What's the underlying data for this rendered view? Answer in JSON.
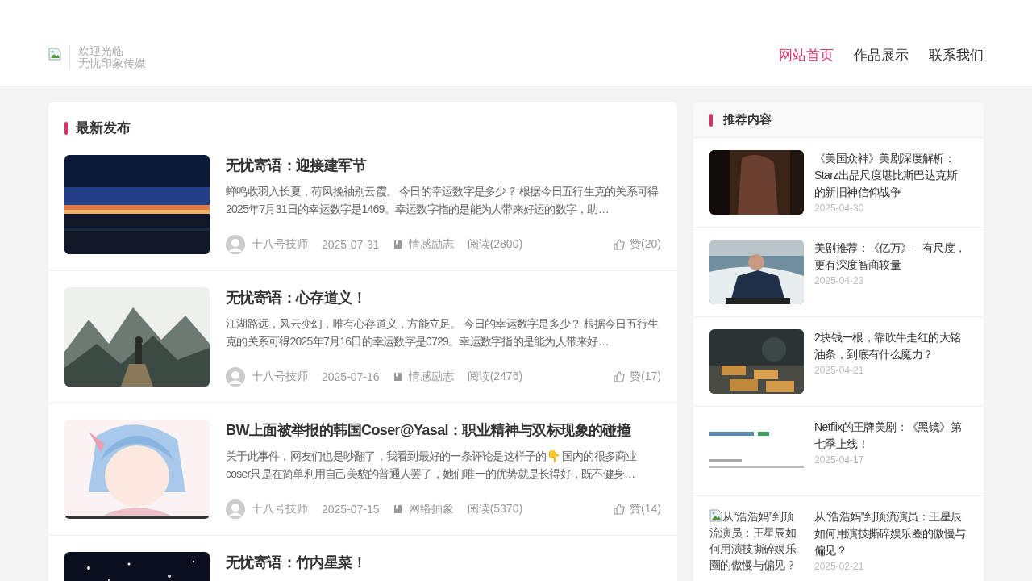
{
  "header": {
    "logo": {
      "kind": "broken-image"
    },
    "welcome": "欢迎光临",
    "site_name": "无忧印象传媒",
    "nav": [
      {
        "label": "网站首页",
        "selected": true
      },
      {
        "label": "作品展示",
        "selected": false
      },
      {
        "label": "联系我们",
        "selected": false
      }
    ]
  },
  "latest": {
    "title": "最新发布",
    "articles": [
      {
        "title": "无忧寄语：迎接建军节",
        "excerpt": "蝉鸣收羽入长夏，荷风挽袖别云霞。 今日的幸运数字是多少？ 根据今日五行生克的关系可得2025年7月31日的幸运数字是1469。幸运数字指的是能为人带来好运的数字，助…",
        "author": "十八号技师",
        "date": "2025-07-31",
        "category": "情感励志",
        "reads": "阅读(2800)",
        "likes": "赞(20)"
      },
      {
        "title": "无忧寄语：心存道义！",
        "excerpt": "江湖路远，风云变幻，唯有心存道义，方能立足。 今日的幸运数字是多少？ 根据今日五行生克的关系可得2025年7月16日的幸运数字是0729。幸运数字指的是能为人带来好…",
        "author": "十八号技师",
        "date": "2025-07-16",
        "category": "情感励志",
        "reads": "阅读(2476)",
        "likes": "赞(17)"
      },
      {
        "title": "BW上面被举报的韩国Coser@Yasal：职业精神与双标现象的碰撞",
        "excerpt": "关于此事件，网友们也是吵翻了，我看到最好的一条评论是这样子的👇 国内的很多商业coser只是在简单利用自己美貌的普通人罢了，她们唯一的优势就是长得好，既不健身…",
        "author": "十八号技师",
        "date": "2025-07-15",
        "category": "网络抽象",
        "reads": "阅读(5370)",
        "likes": "赞(14)"
      },
      {
        "title": "无忧寄语：竹内星菜！"
      }
    ]
  },
  "recommended": {
    "title": "推荐内容",
    "items": [
      {
        "title": "《美国众神》美剧深度解析：Starz出品尺度堪比斯巴达克斯的新旧神信仰战争",
        "date": "2025-04-30"
      },
      {
        "title": "美剧推荐：《亿万》—有尺度，更有深度智商较量",
        "date": "2025-04-23"
      },
      {
        "title": "2块钱一根，靠吹牛走红的大铭油条，到底有什么魔力？",
        "date": "2025-04-21"
      },
      {
        "title": "Netflix的王牌美剧：《黑镜》第七季上线！",
        "date": "2025-04-17"
      },
      {
        "thumbnail": {
          "kind": "broken-image",
          "alt": "从“浩浩妈”到顶流演员：王星辰如何用演技撕碎娱乐圈的傲慢与偏见？"
        },
        "title": "从“浩浩妈”到顶流演员：王星辰如何用演技撕碎娱乐圈的傲慢与偏见？",
        "date": "2025-02-21"
      }
    ]
  }
}
